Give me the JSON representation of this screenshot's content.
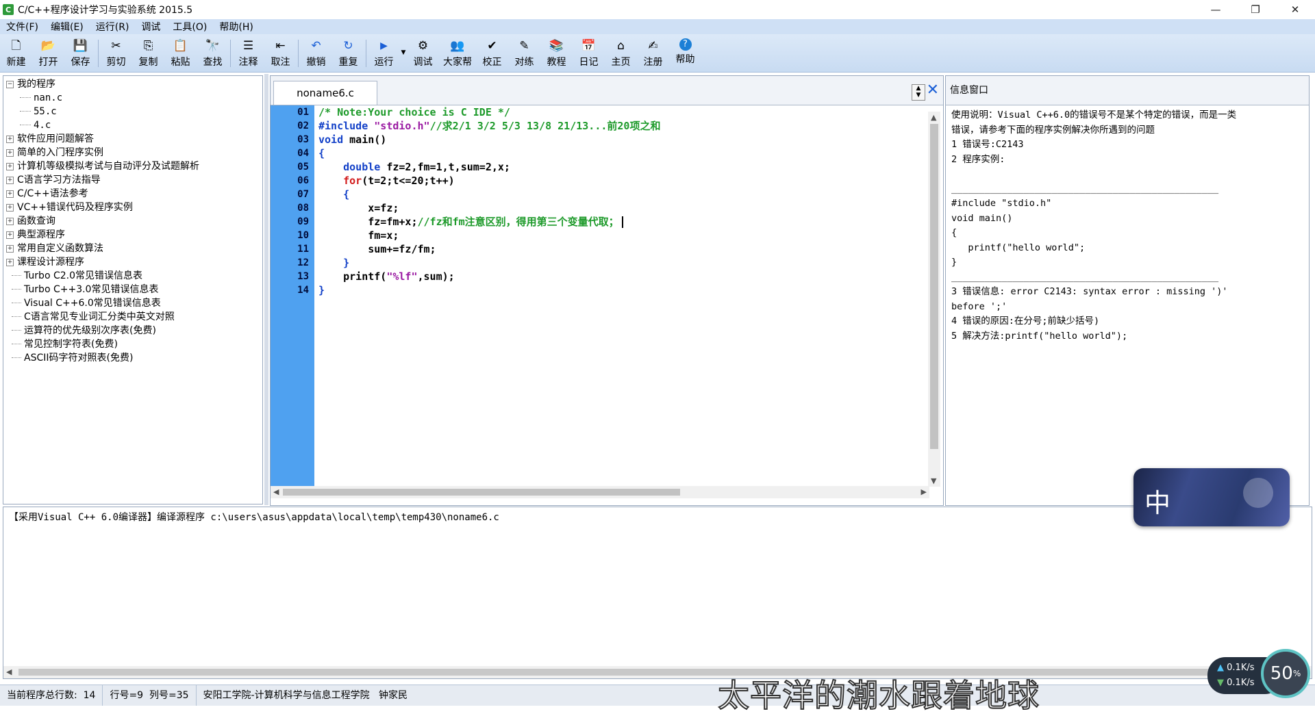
{
  "window": {
    "title": "C/C++程序设计学习与实验系统 2015.5",
    "app_icon_letter": "C",
    "minimize_icon": "—",
    "maximize_icon": "❐",
    "close_icon": "✕"
  },
  "menu": [
    "文件(F)",
    "编辑(E)",
    "运行(R)",
    "调试",
    "工具(O)",
    "帮助(H)"
  ],
  "toolbar": [
    {
      "label": "新建",
      "icon": "new-file-icon",
      "glyph": "🗋"
    },
    {
      "label": "打开",
      "icon": "open-folder-icon",
      "glyph": "📂"
    },
    {
      "label": "保存",
      "icon": "save-icon",
      "glyph": "💾"
    },
    {
      "label": "剪切",
      "icon": "cut-icon",
      "glyph": "✂"
    },
    {
      "label": "复制",
      "icon": "copy-icon",
      "glyph": "⎘"
    },
    {
      "label": "粘贴",
      "icon": "paste-icon",
      "glyph": "📋"
    },
    {
      "label": "查找",
      "icon": "find-icon",
      "glyph": "🔭"
    },
    {
      "label": "注释",
      "icon": "comment-icon",
      "glyph": "☰"
    },
    {
      "label": "取注",
      "icon": "uncomment-icon",
      "glyph": "⇤"
    },
    {
      "label": "撤销",
      "icon": "undo-icon",
      "glyph": "↶"
    },
    {
      "label": "重复",
      "icon": "redo-icon",
      "glyph": "↻"
    },
    {
      "label": "运行",
      "icon": "run-icon",
      "glyph": "▶"
    },
    {
      "label": "调试",
      "icon": "debug-icon",
      "glyph": "⚙"
    },
    {
      "label": "大家帮",
      "icon": "help-each-other-icon",
      "glyph": "👥"
    },
    {
      "label": "校正",
      "icon": "check-icon",
      "glyph": "✔"
    },
    {
      "label": "对练",
      "icon": "practice-icon",
      "glyph": "✎"
    },
    {
      "label": "教程",
      "icon": "tutorial-icon",
      "glyph": "📚"
    },
    {
      "label": "日记",
      "icon": "diary-icon",
      "glyph": "📅"
    },
    {
      "label": "主页",
      "icon": "home-icon",
      "glyph": "⌂"
    },
    {
      "label": "注册",
      "icon": "register-icon",
      "glyph": "✍"
    },
    {
      "label": "帮助",
      "icon": "help-icon",
      "glyph": "?"
    }
  ],
  "colors": {
    "accent": "#4fa1f0",
    "keyword": "#1240c8",
    "comment": "#1d9a2a",
    "string": "#9a1aa2",
    "operator": "#d21b1b"
  },
  "tree": {
    "root": "我的程序",
    "files": [
      "nan.c",
      "55.c",
      "4.c"
    ],
    "folders": [
      "软件应用问题解答",
      "简单的入门程序实例",
      "计算机等级模拟考试与自动评分及试题解析",
      "C语言学习方法指导",
      "C/C++语法参考",
      "VC++错误代码及程序实例",
      "函数查询",
      "典型源程序",
      "常用自定义函数算法",
      "课程设计源程序"
    ],
    "leaves": [
      "Turbo C2.0常见错误信息表",
      "Turbo C++3.0常见错误信息表",
      "Visual C++6.0常见错误信息表",
      "C语言常见专业词汇分类中英文对照",
      "运算符的优先级别次序表(免费)",
      "常见控制字符表(免费)",
      "ASCII码字符对照表(免费)"
    ]
  },
  "editor": {
    "tab_label": "noname6.c",
    "line_numbers": [
      "01",
      "02",
      "03",
      "04",
      "05",
      "06",
      "07",
      "08",
      "09",
      "10",
      "11",
      "12",
      "13",
      "14"
    ],
    "code": {
      "l1": "/* Note:Your choice is C IDE */",
      "l2_pp": "#include ",
      "l2_str": "\"stdio.h\"",
      "l2_cm": "//求2/1 3/2 5/3 13/8 21/13...前20项之和",
      "l3_kw": "void",
      "l3_rest": " main()",
      "l4": "{",
      "l5_kw": "double",
      "l5_rest": " fz=2,fm=1,t,sum=2,x;",
      "l6_kw": "for",
      "l6_rest": "(t=2;t<=20;t++)",
      "l7": "    {",
      "l8": "x=fz;",
      "l9_code": "fz=fm+x;",
      "l9_cm": "//fz和fm注意区别，得用第三个变量代取；",
      "l10": "fm=x;",
      "l11": "sum+=fz/fm;",
      "l12": "    }",
      "l13_a": "printf(",
      "l13_str": "\"%lf\"",
      "l13_b": ",sum);",
      "l14": "}"
    }
  },
  "info": {
    "title": "信息窗口",
    "body": "使用说明：Visual C++6.0的错误号不是某个特定的错误，而是一类\n错误，请参考下面的程序实例解决你所遇到的问题\n1 错误号:C2143\n2 程序实例:\n\n________________________________________________\n#include \"stdio.h\"\nvoid main()\n{\n   printf(\"hello world\";\n}\n________________________________________________\n3 错误信息: error C2143: syntax error : missing ')'\nbefore ';'\n4 错误的原因:在分号;前缺少括号)\n5 解决方法:printf(\"hello world\");"
  },
  "output": {
    "text": "【采用Visual C++ 6.0编译器】编译源程序 c:\\users\\asus\\appdata\\local\\temp\\temp430\\noname6.c"
  },
  "status": {
    "total_lines_label": "当前程序总行数:",
    "total_lines": "14",
    "line_col": "行号=9  列号=35",
    "org": "安阳工学院-计算机科学与信息工程学院",
    "author": "钟家民"
  },
  "overlay": {
    "subtitle": "太平洋的潮水跟着地球",
    "ime_char": "中",
    "net_up": "0.1K/s",
    "net_down": "0.1K/s",
    "net_percent": "50"
  }
}
